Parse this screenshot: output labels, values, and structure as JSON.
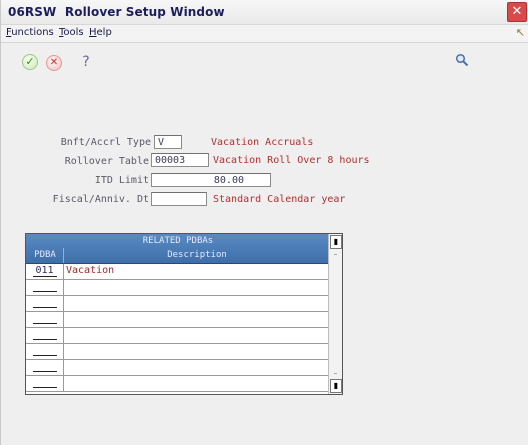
{
  "window": {
    "title_code": "06RSW",
    "title_text": "Rollover Setup Window",
    "close_glyph": "✕"
  },
  "menu": {
    "items": [
      {
        "label_u": "F",
        "label_rest": "unctions"
      },
      {
        "label_u": "T",
        "label_rest": "ools"
      },
      {
        "label_u": "H",
        "label_rest": "elp"
      }
    ]
  },
  "toolbar": {
    "ok_icon": "check-icon",
    "cancel_icon": "cancel-icon",
    "help_glyph": "?",
    "search_icon": "magnifier-icon"
  },
  "form": {
    "benefit_type": {
      "label": "Bnft/Accrl Type",
      "value": "V",
      "description": "Vacation Accruals"
    },
    "rollover_table": {
      "label": "Rollover Table",
      "value": "00003",
      "description": "Vacation Roll Over 8 hours"
    },
    "itd_limit": {
      "label": "ITD Limit",
      "value": "80.00"
    },
    "fiscal_anniv": {
      "label": "Fiscal/Anniv. Dt",
      "value": "",
      "description": "Standard Calendar year"
    }
  },
  "grid": {
    "title": "RELATED PDBAs",
    "columns": [
      "PDBA",
      "Description"
    ],
    "rows": [
      {
        "pdba": "011",
        "description": "Vacation"
      },
      {
        "pdba": "",
        "description": ""
      },
      {
        "pdba": "",
        "description": ""
      },
      {
        "pdba": "",
        "description": ""
      },
      {
        "pdba": "",
        "description": ""
      },
      {
        "pdba": "",
        "description": ""
      },
      {
        "pdba": "",
        "description": ""
      },
      {
        "pdba": "",
        "description": ""
      }
    ]
  },
  "colors": {
    "title": "#1d1d5b",
    "description_text": "#b03030",
    "grid_header": "#4a7ab8"
  }
}
